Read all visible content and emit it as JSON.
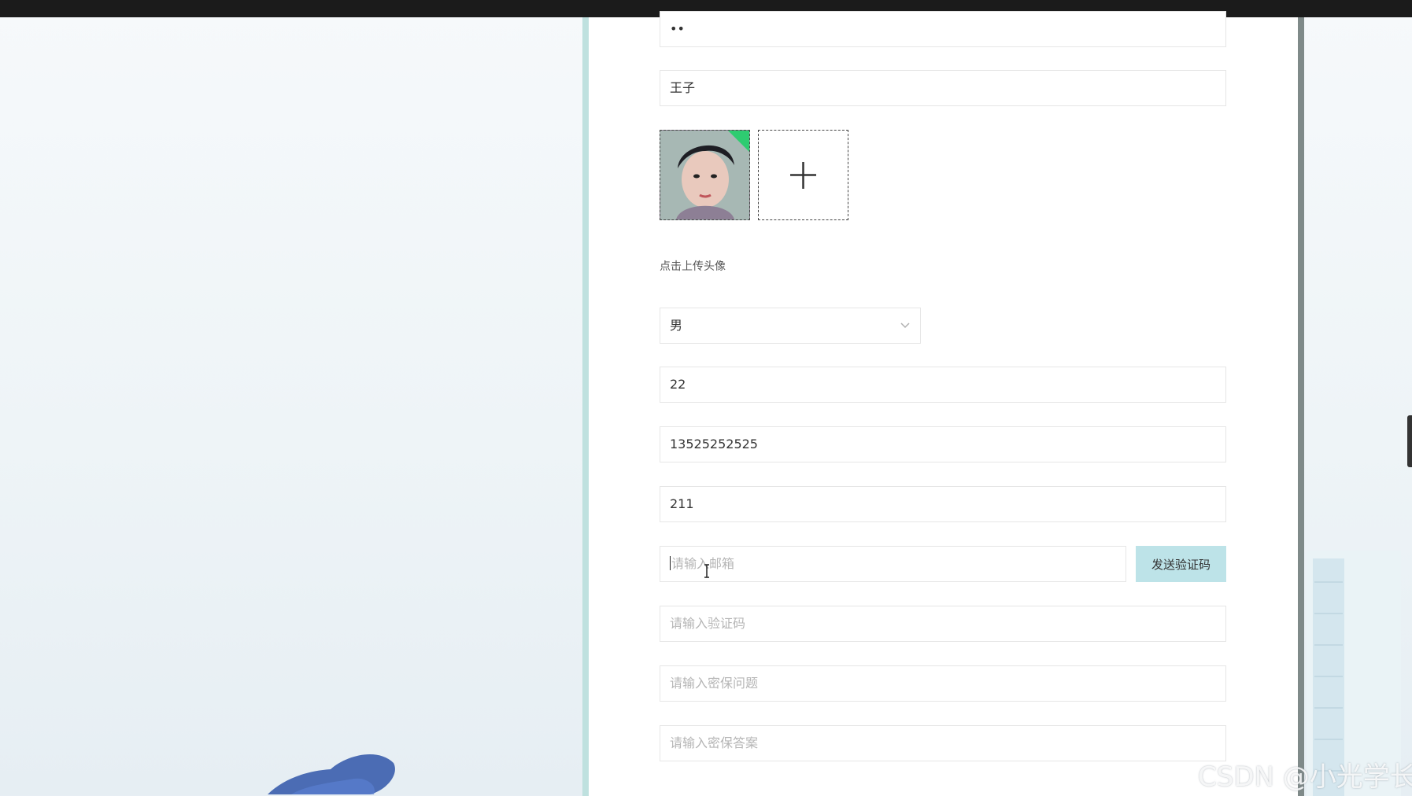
{
  "form": {
    "password_masked": "••",
    "name_value": "王子",
    "avatar_hint": "点击上传头像",
    "gender_selected": "男",
    "age_value": "22",
    "phone_value": "13525252525",
    "field_211_value": "211",
    "email_placeholder": "请输入邮箱",
    "send_code_label": "发送验证码",
    "code_placeholder": "请输入验证码",
    "security_question_placeholder": "请输入密保问题",
    "security_answer_placeholder": "请输入密保答案"
  },
  "icons": {
    "upload_add": "plus-icon",
    "select_chevron": "chevron-down-icon",
    "text_cursor": "text-cursor-icon"
  },
  "colors": {
    "send_button_bg": "#bde3e8",
    "card_left_border": "#bfe1df",
    "card_right_border": "#7f8a89",
    "avatar_badge": "#2ecc71"
  },
  "watermark": "CSDN @小光学长"
}
